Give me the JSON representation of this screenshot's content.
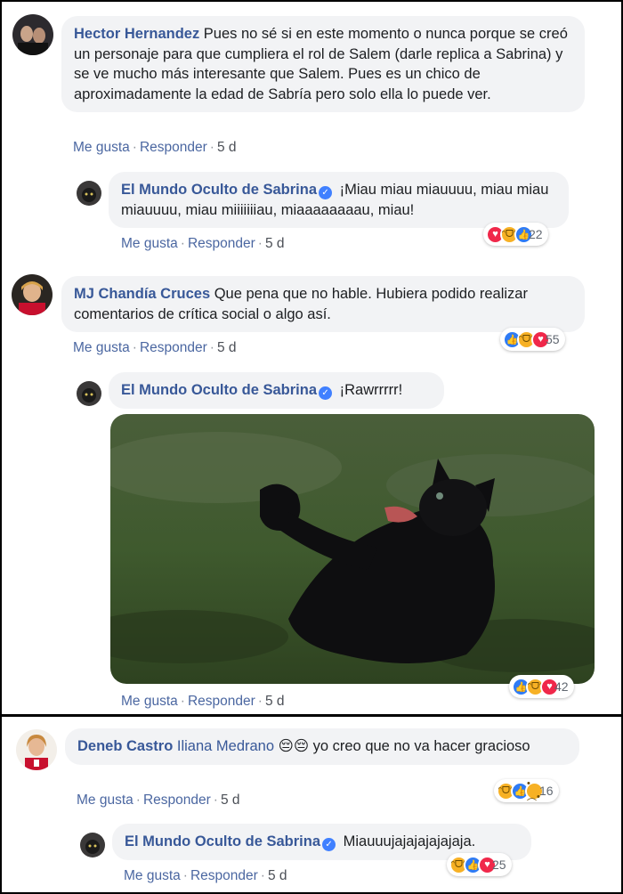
{
  "colors": {
    "name_link": "#385898",
    "action_link": "#4b67a1",
    "bubble_bg": "#f2f3f5",
    "like": "#2e7bf5",
    "love": "#f0284a",
    "haha": "#f7b125"
  },
  "actions": {
    "like": "Me gusta",
    "reply": "Responder",
    "sep": "·",
    "time": "5 d"
  },
  "comments": [
    {
      "author": "Hector Hernandez",
      "text": "Pues no sé si en este momento o nunca porque se creó un personaje para que cumpliera el rol de Salem (darle replica a Sabrina) y se ve mucho más interesante que Salem. Pues es un chico de aproximadamente la edad de Sabría pero solo ella lo puede ver.",
      "reply": {
        "author": "El Mundo Oculto de Sabrina",
        "text": "¡Miau miau miauuuu, miau miau miauuuu, miau miiiiiiiau, miaaaaaaaau, miau!",
        "reactions": [
          "love-icon",
          "haha-icon",
          "like-icon"
        ],
        "reaction_count": "22"
      }
    },
    {
      "author": "MJ Chandía Cruces",
      "text": "Que pena que no hable. Hubiera podido realizar comentarios de crítica social o algo así.",
      "reactions": [
        "like-icon",
        "haha-icon",
        "love-icon"
      ],
      "reaction_count": "55",
      "reply": {
        "author": "El Mundo Oculto de Sabrina",
        "text": "¡Rawrrrrr!",
        "image": "black-cat-photo",
        "reactions": [
          "like-icon",
          "haha-icon",
          "love-icon"
        ],
        "reaction_count": "42"
      }
    },
    {
      "author": "Deneb Castro",
      "mention": "Iliana Medrano",
      "emoji": "😔😔",
      "text": "yo creo que no va hacer gracioso",
      "reactions": [
        "haha-icon",
        "like-icon",
        "sad-icon"
      ],
      "reaction_count": "16",
      "reply": {
        "author": "El Mundo Oculto de Sabrina",
        "text": "Miauuujajajajajajaja.",
        "reactions": [
          "haha-icon",
          "like-icon",
          "love-icon"
        ],
        "reaction_count": "25"
      }
    }
  ]
}
